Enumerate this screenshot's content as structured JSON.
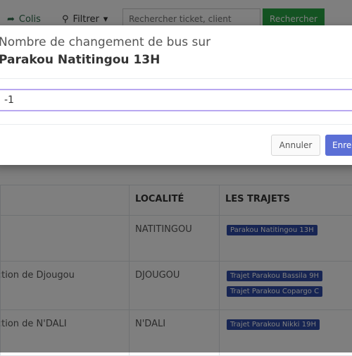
{
  "toolbar": {
    "colis_label": "Colis",
    "filtrer_label": "Filtrer",
    "search_placeholder": "Rechercher ticket, client",
    "search_button": "Rechercher"
  },
  "table": {
    "headers": [
      "",
      "LOCALITÉ",
      "LES TRAJETS"
    ],
    "rows": [
      {
        "name": "",
        "localite": "NATITINGOU",
        "trajets": [
          "Parakou Natitingou 13H"
        ]
      },
      {
        "name": "ection de Djougou",
        "localite": "DJOUGOU",
        "trajets": [
          "Trajet Parakou Bassila 9H",
          "Trajet Parakou Copargo C"
        ]
      },
      {
        "name": "ection de N'DALI",
        "localite": "N'DALI",
        "trajets": [
          "Trajet Parakou Nikki 19H"
        ]
      }
    ]
  },
  "modal": {
    "title_line1": "Nombre de changement de bus sur",
    "title_line2": "Parakou Natitingou 13H",
    "input_value": "-1",
    "cancel_label": "Annuler",
    "save_label": "Enre"
  },
  "colors": {
    "accent": "#28a745",
    "tag": "#2e4aa6",
    "primary_button": "#5b6fd6",
    "input_focus": "#b9a8f0"
  }
}
